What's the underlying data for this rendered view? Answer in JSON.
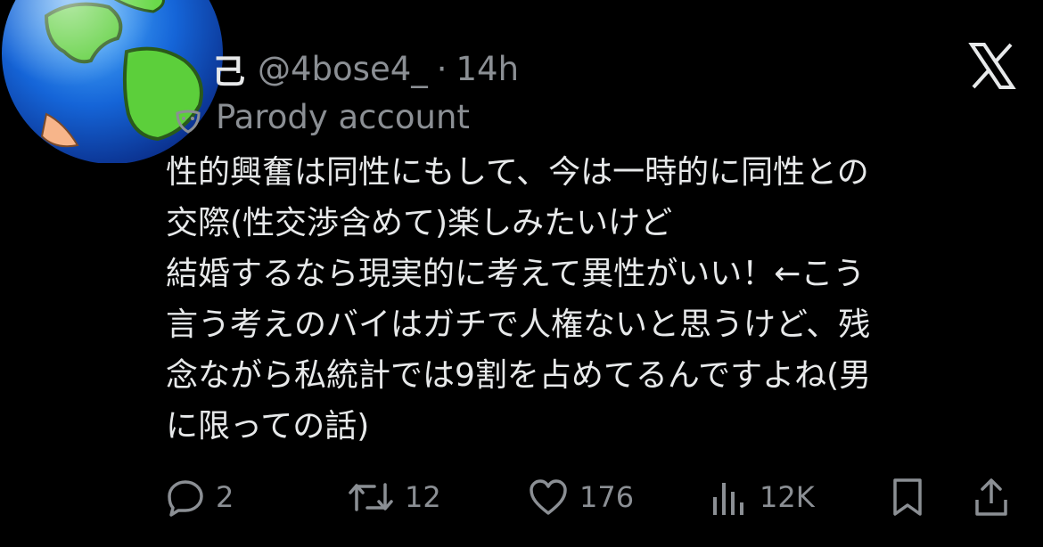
{
  "tweet": {
    "name_fragment": "己",
    "handle": "@4bose4_",
    "separator": "·",
    "time": "14h",
    "parody_label": "Parody account",
    "text_lines": [
      "性的興奮は同性にもして、今は一時的に同性との",
      "交際(性交渉含めて)楽しみたいけど",
      "結婚するなら現実的に考えて異性がいい！←こう",
      "言う考えのバイはガチで人権ないと思うけど、残",
      "念ながら私統計では9割を占めてるんですよね(男",
      "に限っての話)"
    ]
  },
  "actions": {
    "reply_count": "2",
    "retweet_count": "12",
    "like_count": "176",
    "views_count": "12K"
  },
  "icons": {
    "avatar": "globe-avatar",
    "logo": "x-logo-icon",
    "parody": "parody-mask-icon",
    "reply": "reply-icon",
    "retweet": "retweet-icon",
    "like": "heart-icon",
    "views": "views-icon",
    "bookmark": "bookmark-icon",
    "share": "share-icon"
  },
  "colors": {
    "background": "#000000",
    "text": "#e7e9ea",
    "secondary": "#8b8f94"
  }
}
